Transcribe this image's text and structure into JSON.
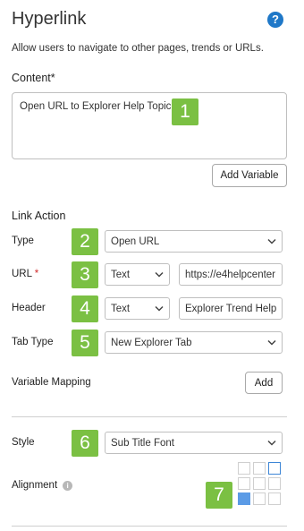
{
  "header": {
    "title": "Hyperlink",
    "description": "Allow users to navigate to other pages, trends or URLs."
  },
  "content": {
    "label": "Content",
    "required_mark": "*",
    "value": "Open URL to Explorer Help Topic",
    "add_variable_label": "Add Variable"
  },
  "link_action": {
    "heading": "Link Action",
    "type": {
      "label": "Type",
      "value": "Open URL"
    },
    "url": {
      "label": "URL",
      "required_mark": "*",
      "mode": "Text",
      "value": "https://e4helpcenter"
    },
    "header": {
      "label": "Header",
      "mode": "Text",
      "value": "Explorer Trend Help"
    },
    "tab_type": {
      "label": "Tab Type",
      "value": "New Explorer Tab"
    },
    "variable_mapping": {
      "label": "Variable Mapping",
      "add_label": "Add"
    }
  },
  "style": {
    "label": "Style",
    "value": "Sub Title Font"
  },
  "alignment": {
    "label": "Alignment",
    "selected": "bottom-left"
  },
  "badges": [
    "1",
    "2",
    "3",
    "4",
    "5",
    "6",
    "7"
  ],
  "colors": {
    "badge": "#7bc043",
    "help_icon": "#1f78c8",
    "required": "#d12a2a",
    "selected_cell": "#5b9be6"
  }
}
